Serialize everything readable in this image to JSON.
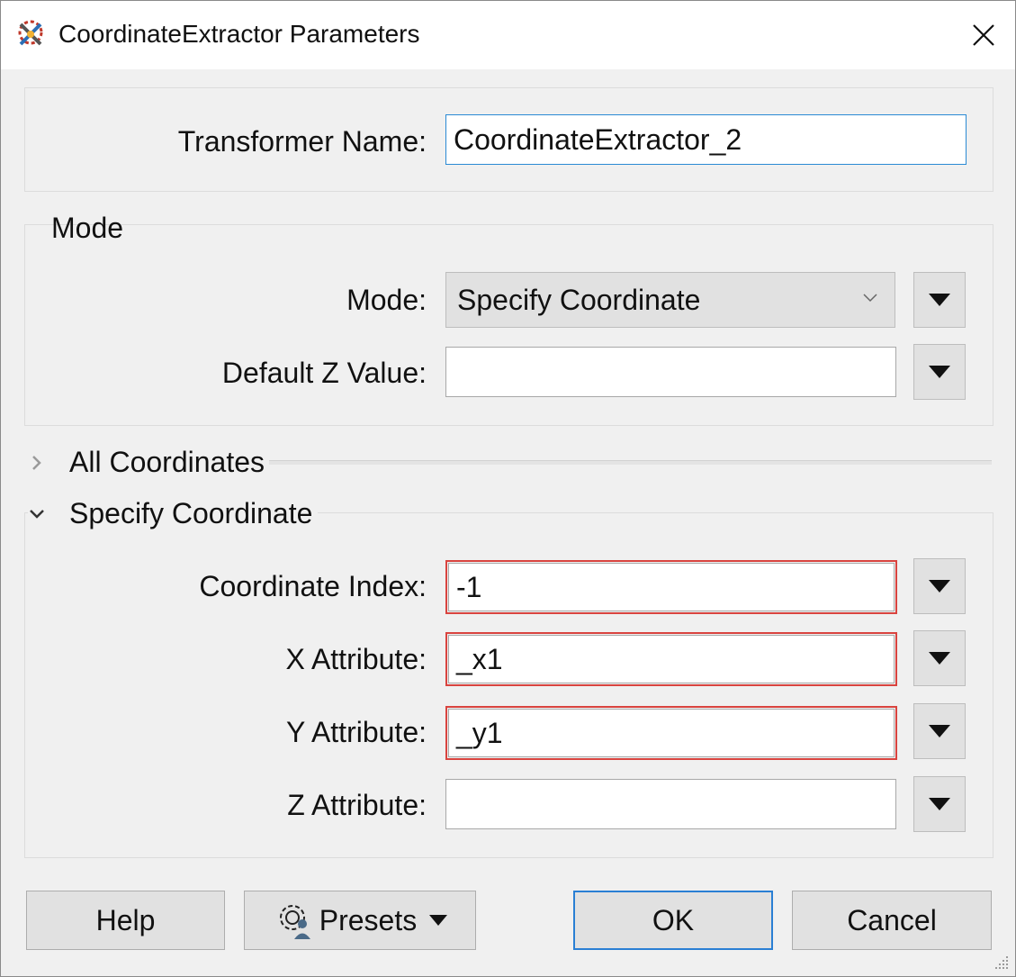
{
  "window": {
    "title": "CoordinateExtractor Parameters"
  },
  "transformer": {
    "label": "Transformer Name:",
    "value": "CoordinateExtractor_2"
  },
  "mode_group": {
    "title": "Mode",
    "mode_label": "Mode:",
    "mode_value": "Specify Coordinate",
    "default_z_label": "Default Z Value:",
    "default_z_value": ""
  },
  "sections": {
    "all_coordinates": "All Coordinates",
    "specify_coordinate": "Specify Coordinate"
  },
  "specify": {
    "coord_index_label": "Coordinate Index:",
    "coord_index_value": "-1",
    "x_label": "X Attribute:",
    "x_value": "_x1",
    "y_label": "Y Attribute:",
    "y_value": "_y1",
    "z_label": "Z Attribute:",
    "z_value": ""
  },
  "buttons": {
    "help": "Help",
    "presets": "Presets",
    "ok": "OK",
    "cancel": "Cancel"
  },
  "colors": {
    "highlight": "#d9443f",
    "focus": "#2a8ad4"
  }
}
